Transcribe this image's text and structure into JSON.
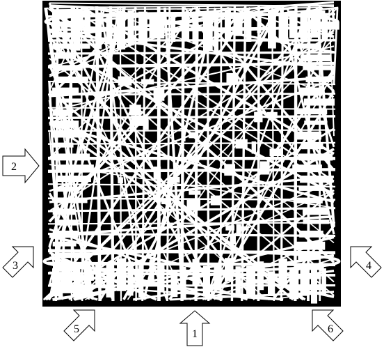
{
  "puzzle": {
    "board_color": "#000000",
    "pattern_color": "#ffffff",
    "arrows": [
      {
        "id": 1,
        "label": "1",
        "direction": "up"
      },
      {
        "id": 2,
        "label": "2",
        "direction": "right"
      },
      {
        "id": 3,
        "label": "3",
        "direction": "up-right"
      },
      {
        "id": 4,
        "label": "4",
        "direction": "up-left"
      },
      {
        "id": 5,
        "label": "5",
        "direction": "up-right"
      },
      {
        "id": 6,
        "label": "6",
        "direction": "up-left"
      }
    ]
  }
}
